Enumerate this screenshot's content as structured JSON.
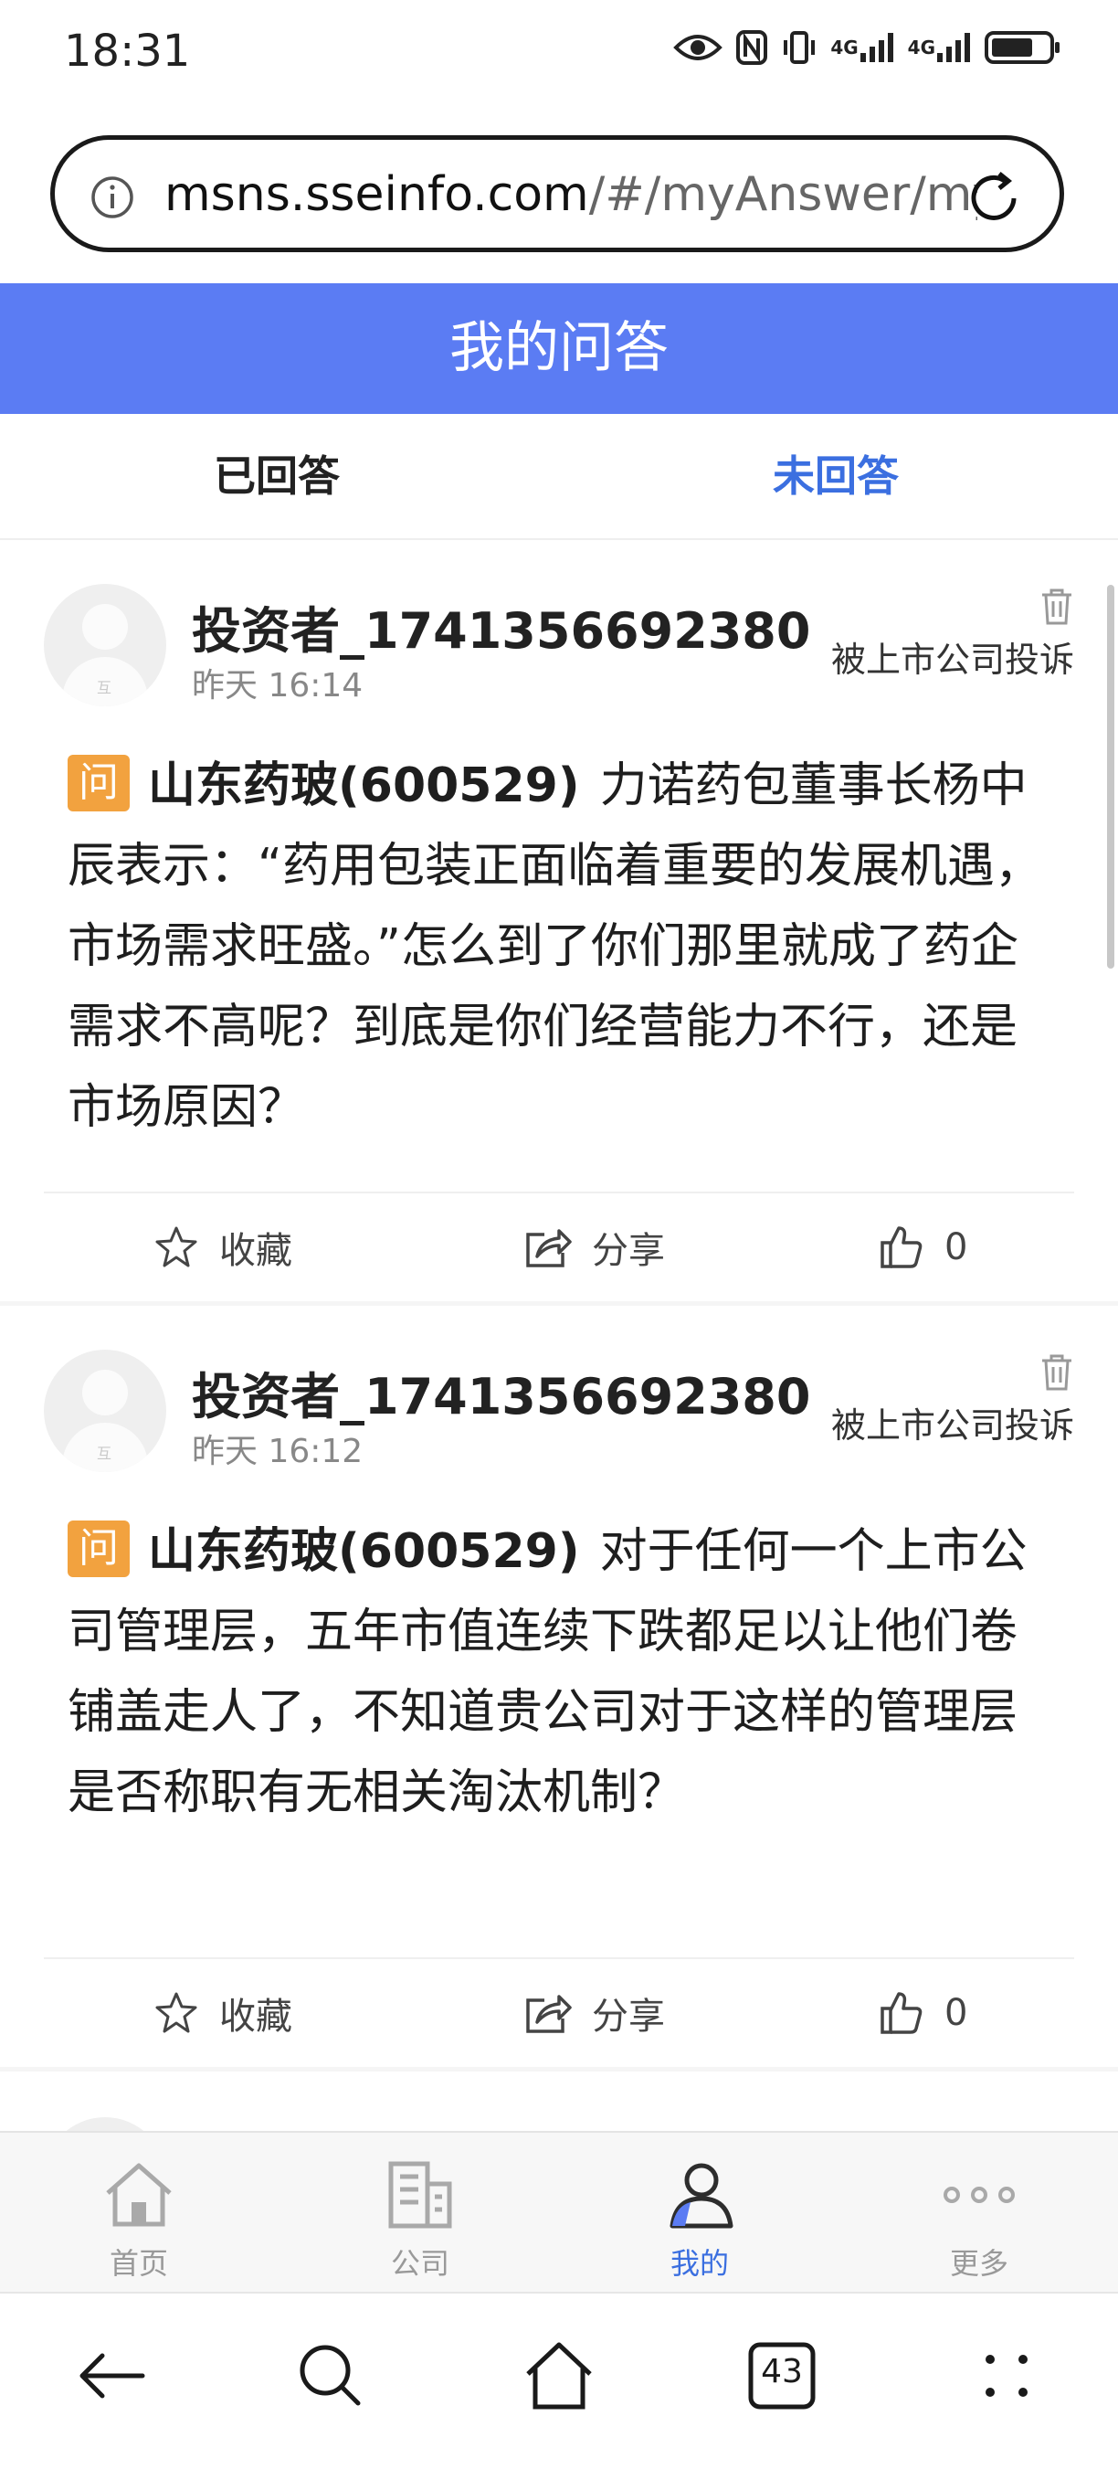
{
  "status": {
    "time": "18:31",
    "network1": "4G",
    "network2": "4G"
  },
  "browser": {
    "url_host": "msns.sseinfo.com",
    "url_path": "/#/myAnswer/my"
  },
  "page": {
    "title": "我的问答"
  },
  "tabs": [
    {
      "label": "已回答"
    },
    {
      "label": "未回答"
    }
  ],
  "questions": [
    {
      "user": "投资者_1741356692380",
      "time": "昨天 16:14",
      "complaint": "被上市公司投诉",
      "badge": "问",
      "company": "山东药玻(600529)",
      "text": "力诺药包董事长杨中辰表示：“药用包装正面临着重要的发展机遇，市场需求旺盛。”怎么到了你们那里就成了药企需求不高呢？到底是你们经营能力不行，还是市场原因？",
      "fav": "收藏",
      "share": "分享",
      "likes": "0"
    },
    {
      "user": "投资者_1741356692380",
      "time": "昨天 16:12",
      "complaint": "被上市公司投诉",
      "badge": "问",
      "company": "山东药玻(600529)",
      "text": "对于任何一个上市公司管理层，五年市值连续下跌都足以让他们卷铺盖走人了，不知道贵公司对于这样的管理层是否称职有无相关淘汰机制？",
      "fav": "收藏",
      "share": "分享",
      "likes": "0"
    }
  ],
  "avatar_mark": "互",
  "bottom_nav": [
    {
      "label": "首页",
      "icon": "home-icon"
    },
    {
      "label": "公司",
      "icon": "building-icon"
    },
    {
      "label": "我的",
      "icon": "person-icon",
      "active": true
    },
    {
      "label": "更多",
      "icon": "more-icon"
    }
  ],
  "system_nav": {
    "tab_count": "43"
  },
  "colors": {
    "brand_blue": "#5b7cf3",
    "active_tab": "#3b6fe0",
    "question_badge": "#f2a23f"
  }
}
